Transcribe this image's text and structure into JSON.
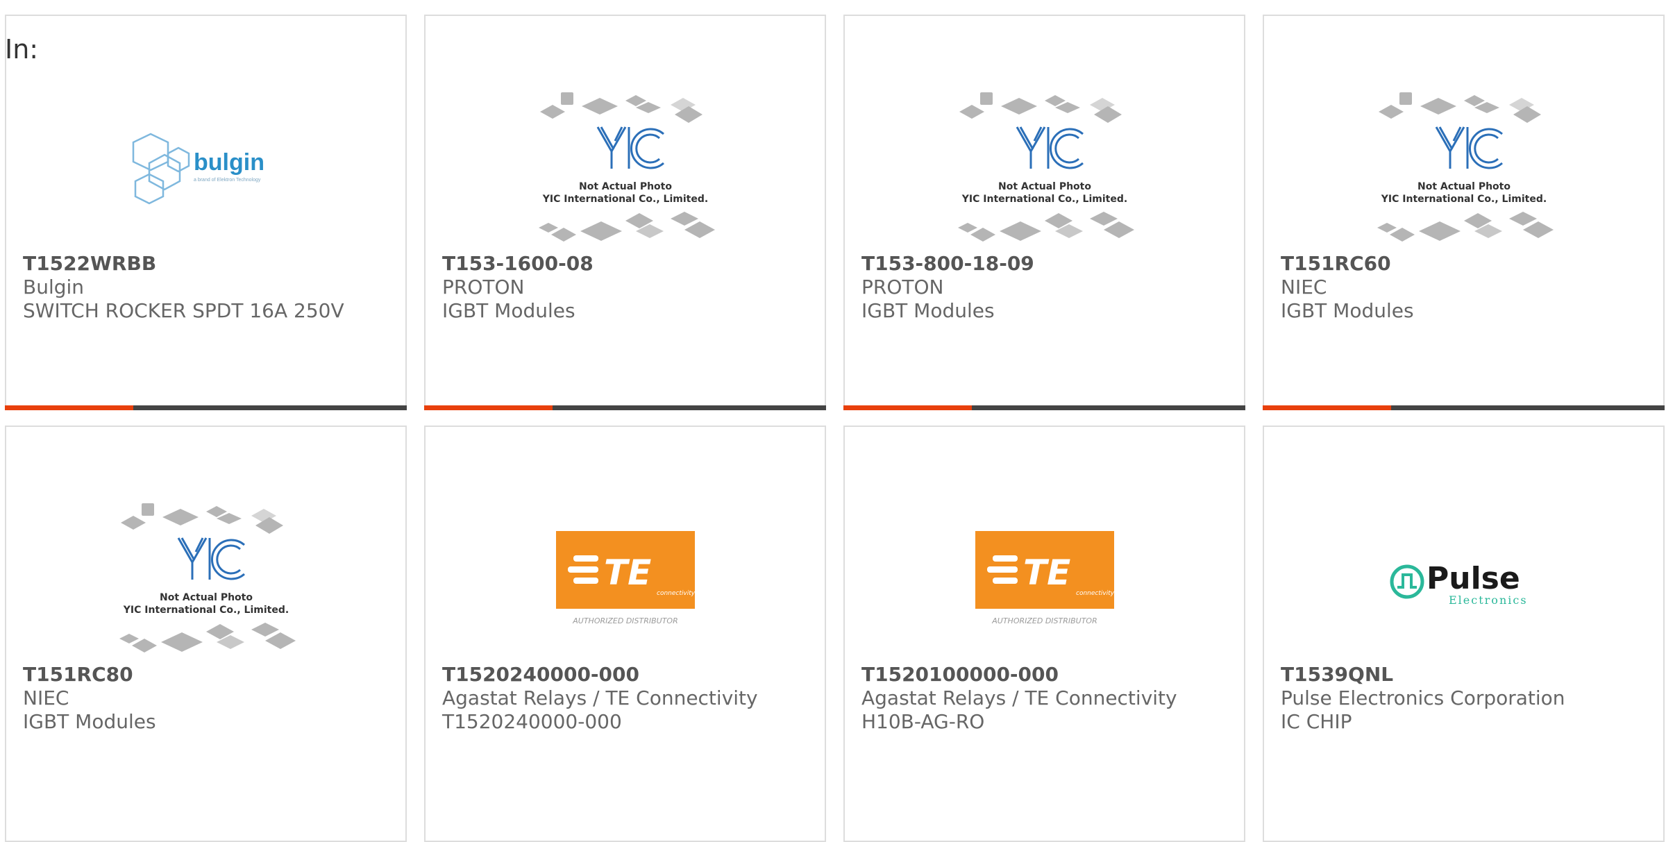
{
  "header": {
    "in_label": "In:"
  },
  "colors": {
    "accent": "#e8400c",
    "bar_dark": "#444444",
    "te_orange": "#f39020",
    "pulse_green": "#2bb89a",
    "bulgin_blue": "#2a8fc8",
    "yic_blue": "#2b6fb8"
  },
  "products": [
    {
      "part_number": "T1522WRBB",
      "manufacturer": "Bulgin",
      "description": "SWITCH ROCKER SPDT 16A 250V",
      "image": "bulgin-logo",
      "logo_text": "bulgin",
      "logo_sub": "a brand of Elektron Technology"
    },
    {
      "part_number": "T153-1600-08",
      "manufacturer": "PROTON",
      "description": "IGBT Modules",
      "image": "yic-placeholder",
      "logo_text": "YIC",
      "photo_line1": "Not Actual Photo",
      "photo_line2": "YIC International Co., Limited."
    },
    {
      "part_number": "T153-800-18-09",
      "manufacturer": "PROTON",
      "description": "IGBT Modules",
      "image": "yic-placeholder",
      "logo_text": "YIC",
      "photo_line1": "Not Actual Photo",
      "photo_line2": "YIC International Co., Limited."
    },
    {
      "part_number": "T151RC60",
      "manufacturer": "NIEC",
      "description": "IGBT Modules",
      "image": "yic-placeholder",
      "logo_text": "YIC",
      "photo_line1": "Not Actual Photo",
      "photo_line2": "YIC International Co., Limited."
    },
    {
      "part_number": "T151RC80",
      "manufacturer": "NIEC",
      "description": "IGBT Modules",
      "image": "yic-placeholder",
      "logo_text": "YIC",
      "photo_line1": "Not Actual Photo",
      "photo_line2": "YIC International Co., Limited."
    },
    {
      "part_number": "T1520240000-000",
      "manufacturer": "Agastat Relays / TE Connectivity",
      "description": "T1520240000-000",
      "image": "te-logo",
      "logo_text": "TE",
      "logo_sub": "connectivity",
      "logo_caption": "AUTHORIZED DISTRIBUTOR"
    },
    {
      "part_number": "T1520100000-000",
      "manufacturer": "Agastat Relays / TE Connectivity",
      "description": "H10B-AG-RO",
      "image": "te-logo",
      "logo_text": "TE",
      "logo_sub": "connectivity",
      "logo_caption": "AUTHORIZED DISTRIBUTOR"
    },
    {
      "part_number": "T1539QNL",
      "manufacturer": "Pulse Electronics Corporation",
      "description": "IC CHIP",
      "image": "pulse-logo",
      "logo_text": "Pulse",
      "logo_sub": "Electronics"
    }
  ]
}
